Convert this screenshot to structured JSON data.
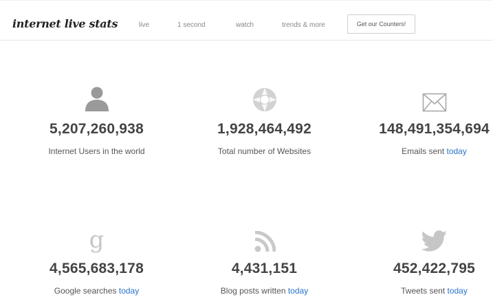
{
  "header": {
    "logo": "internet live stats",
    "nav": [
      {
        "label": "live"
      },
      {
        "label": "1 second"
      },
      {
        "label": "watch"
      },
      {
        "label": "trends & more"
      }
    ],
    "cta_label": "Get our Counters!"
  },
  "stats": [
    {
      "icon": "user-icon",
      "value": "5,207,260,938",
      "label": "Internet Users in the world",
      "suffix": ""
    },
    {
      "icon": "websites-globe-icon",
      "value": "1,928,464,492",
      "label": "Total number of Websites",
      "suffix": ""
    },
    {
      "icon": "envelope-icon",
      "value": "148,491,354,694",
      "label": "Emails sent",
      "suffix": "today"
    },
    {
      "icon": "google-g-icon",
      "value": "4,565,683,178",
      "label": "Google searches",
      "suffix": "today"
    },
    {
      "icon": "rss-feed-icon",
      "value": "4,431,151",
      "label": "Blog posts written",
      "suffix": "today"
    },
    {
      "icon": "twitter-bird-icon",
      "value": "452,422,795",
      "label": "Tweets sent",
      "suffix": "today"
    }
  ],
  "colors": {
    "accent_link": "#2a74c9",
    "value_text": "#444444",
    "icon_gray": "#c6c6c6",
    "user_icon_gray": "#9a9a9a"
  }
}
